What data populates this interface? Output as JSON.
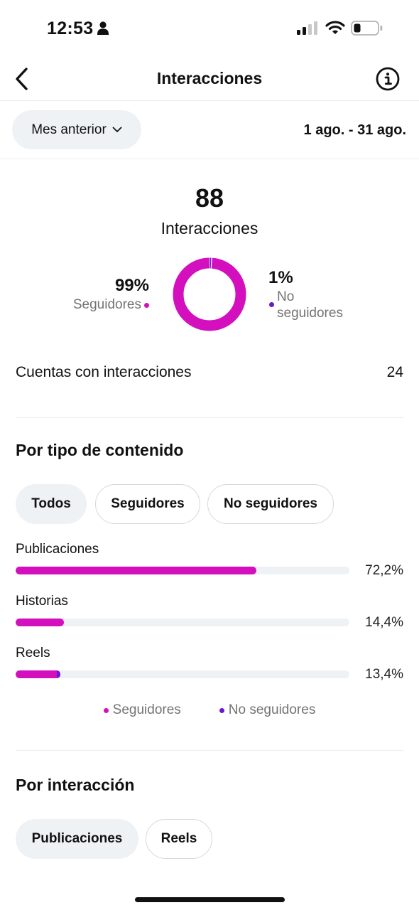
{
  "status_bar": {
    "time": "12:53"
  },
  "header": {
    "title": "Interacciones",
    "back_icon": "chevron-left-icon",
    "info_icon": "info-icon"
  },
  "period": {
    "selector_label": "Mes anterior",
    "date_range": "1 ago. - 31 ago."
  },
  "summary": {
    "total": "88",
    "total_label": "Interacciones",
    "followers_pct": "99%",
    "followers_label": "Seguidores",
    "non_followers_pct": "1%",
    "non_followers_label_line1": "No",
    "non_followers_label_line2": "seguidores",
    "followers_fraction": 0.99,
    "non_followers_fraction": 0.01
  },
  "accounts": {
    "label": "Cuentas con interacciones",
    "value": "24"
  },
  "content_type": {
    "title": "Por tipo de contenido",
    "chips": [
      "Todos",
      "Seguidores",
      "No seguidores"
    ],
    "rows": [
      {
        "label": "Publicaciones",
        "pct_text": "72,2%",
        "followers": 72.2,
        "non_followers": 0
      },
      {
        "label": "Historias",
        "pct_text": "14,4%",
        "followers": 14.4,
        "non_followers": 0
      },
      {
        "label": "Reels",
        "pct_text": "13,4%",
        "followers": 12.4,
        "non_followers": 1.0
      }
    ],
    "legend": {
      "followers": "Seguidores",
      "non_followers": "No seguidores"
    }
  },
  "interaction": {
    "title": "Por interacción",
    "chips": [
      "Publicaciones",
      "Reels"
    ]
  },
  "colors": {
    "followers": "#d40fbe",
    "non_followers": "#6816d9",
    "track": "#eff2f5"
  }
}
